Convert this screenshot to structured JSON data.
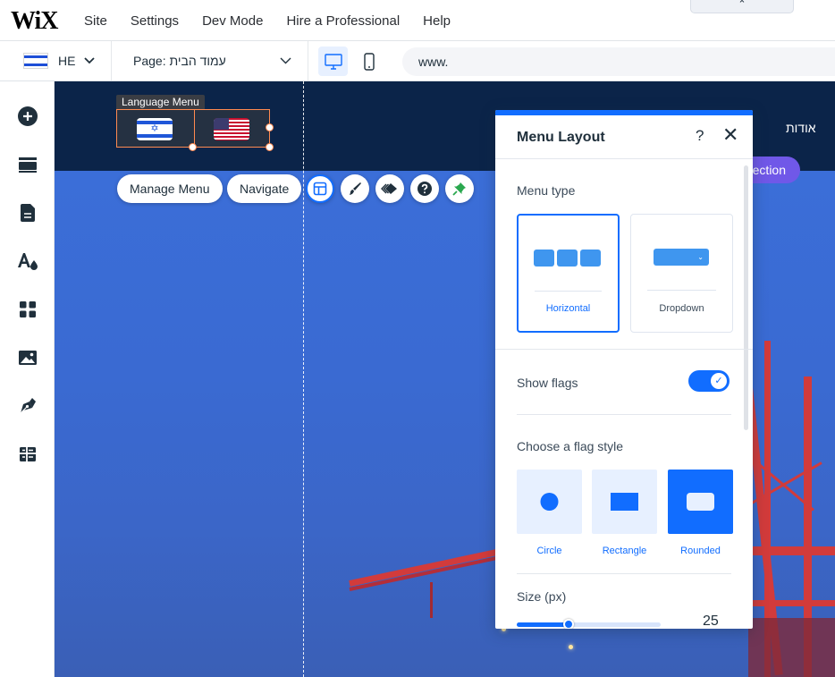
{
  "topbar": {
    "logo": "WiX",
    "menu": [
      "Site",
      "Settings",
      "Dev Mode",
      "Hire a Professional",
      "Help"
    ],
    "collapse_icon": "chevron-up-icon"
  },
  "toolbar": {
    "language_code": "HE",
    "page_label": "Page: עמוד הבית",
    "url": "www."
  },
  "sidebar": {
    "items": [
      "add-icon",
      "sections-icon",
      "pages-icon",
      "design-icon",
      "apps-icon",
      "media-icon",
      "pen-icon",
      "cms-icon"
    ]
  },
  "canvas": {
    "element_tag": "Language Menu",
    "nav_text": "אודות",
    "section_button": "ection",
    "actions": {
      "manage_menu": "Manage Menu",
      "navigate": "Navigate"
    }
  },
  "panel": {
    "title": "Menu Layout",
    "help": "?",
    "close": "✕",
    "menu_type_label": "Menu type",
    "menu_types": [
      {
        "label": "Horizontal",
        "selected": true
      },
      {
        "label": "Dropdown",
        "selected": false
      }
    ],
    "show_flags_label": "Show flags",
    "show_flags_on": true,
    "flag_style_label": "Choose a flag style",
    "flag_styles": [
      {
        "label": "Circle",
        "selected": false
      },
      {
        "label": "Rectangle",
        "selected": false
      },
      {
        "label": "Rounded",
        "selected": true
      }
    ],
    "size_label": "Size (px)",
    "size_value": "25",
    "size_fraction": 0.36
  },
  "colors": {
    "accent": "#116dff",
    "selection": "#ff8a50",
    "header": "#0b2449",
    "section_pill": "#7058e8"
  }
}
